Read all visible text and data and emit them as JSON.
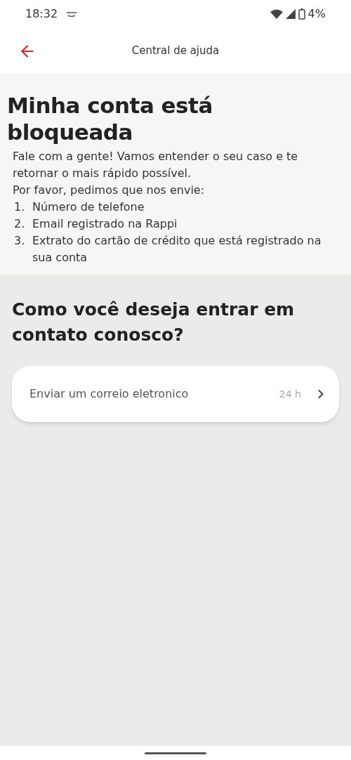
{
  "status_bar": {
    "time": "18:32",
    "battery": "4%"
  },
  "header": {
    "title": "Central de ajuda"
  },
  "info": {
    "title": "Minha conta está bloqueada",
    "paragraphs": [
      "Fale com a gente! Vamos entender o seu caso e te retornar o mais rápido possível.",
      "Por favor, pedimos que nos envie:"
    ],
    "items": [
      {
        "number": "1.",
        "text": "Número de telefone"
      },
      {
        "number": "2.",
        "text": "Email registrado na Rappi"
      },
      {
        "number": "3.",
        "text": "Extrato do cartão de crédito que está registrado na sua conta"
      }
    ]
  },
  "contact": {
    "title": "Como você deseja entrar em contato conosco?",
    "options": [
      {
        "label": "Enviar um correio eletronico",
        "time": "24 h"
      }
    ]
  }
}
